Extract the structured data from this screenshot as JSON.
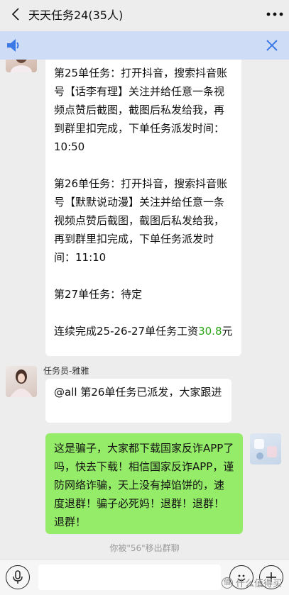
{
  "header": {
    "title": "天天任务24(35人)"
  },
  "voice_bar": {
    "speaker_icon": "speaker-icon",
    "close_icon": "close-icon"
  },
  "messages": {
    "task_post": {
      "para1": "第25单任务：打开抖音，搜索抖音账号【话李有理】关注并给任意一条视频点赞后截图，截图后私发给我，再到群里扣完成，下单任务派发时间：10:50",
      "para2": "第26单任务：打开抖音，搜索抖音账号【默默说动漫】关注并给任意一条视频点赞后截图，截图后私发给我，再到群里扣完成，下单任务派发时间：11:10",
      "para3": "第27单任务：待定",
      "para4_prefix": "连续完成25-26-27单任务工资",
      "amount": "30.8",
      "unit": "元"
    },
    "assistant": {
      "sender": "任务员-雅雅",
      "text": "@all 第26单任务已派发，大家跟进"
    },
    "self": {
      "text": "这是骗子，大家都下载国家反诈APP了吗，快去下载！相信国家反诈APP，谨防网络诈骗，天上没有掉馅饼的，速度退群！骗子必死妈！退群！退群！退群！"
    },
    "system_notice": "你被\"56\"移出群聊"
  },
  "input_bar": {
    "voice_icon": "microphone-icon",
    "emoji_icon": "emoji-icon",
    "plus_icon": "plus-icon"
  },
  "watermark": {
    "badge": "值",
    "text": "什么值得买"
  },
  "colors": {
    "background": "#ededed",
    "voice_bar": "#cfdcf6",
    "self_bubble": "#95ec69",
    "link_green": "#2aa515"
  }
}
